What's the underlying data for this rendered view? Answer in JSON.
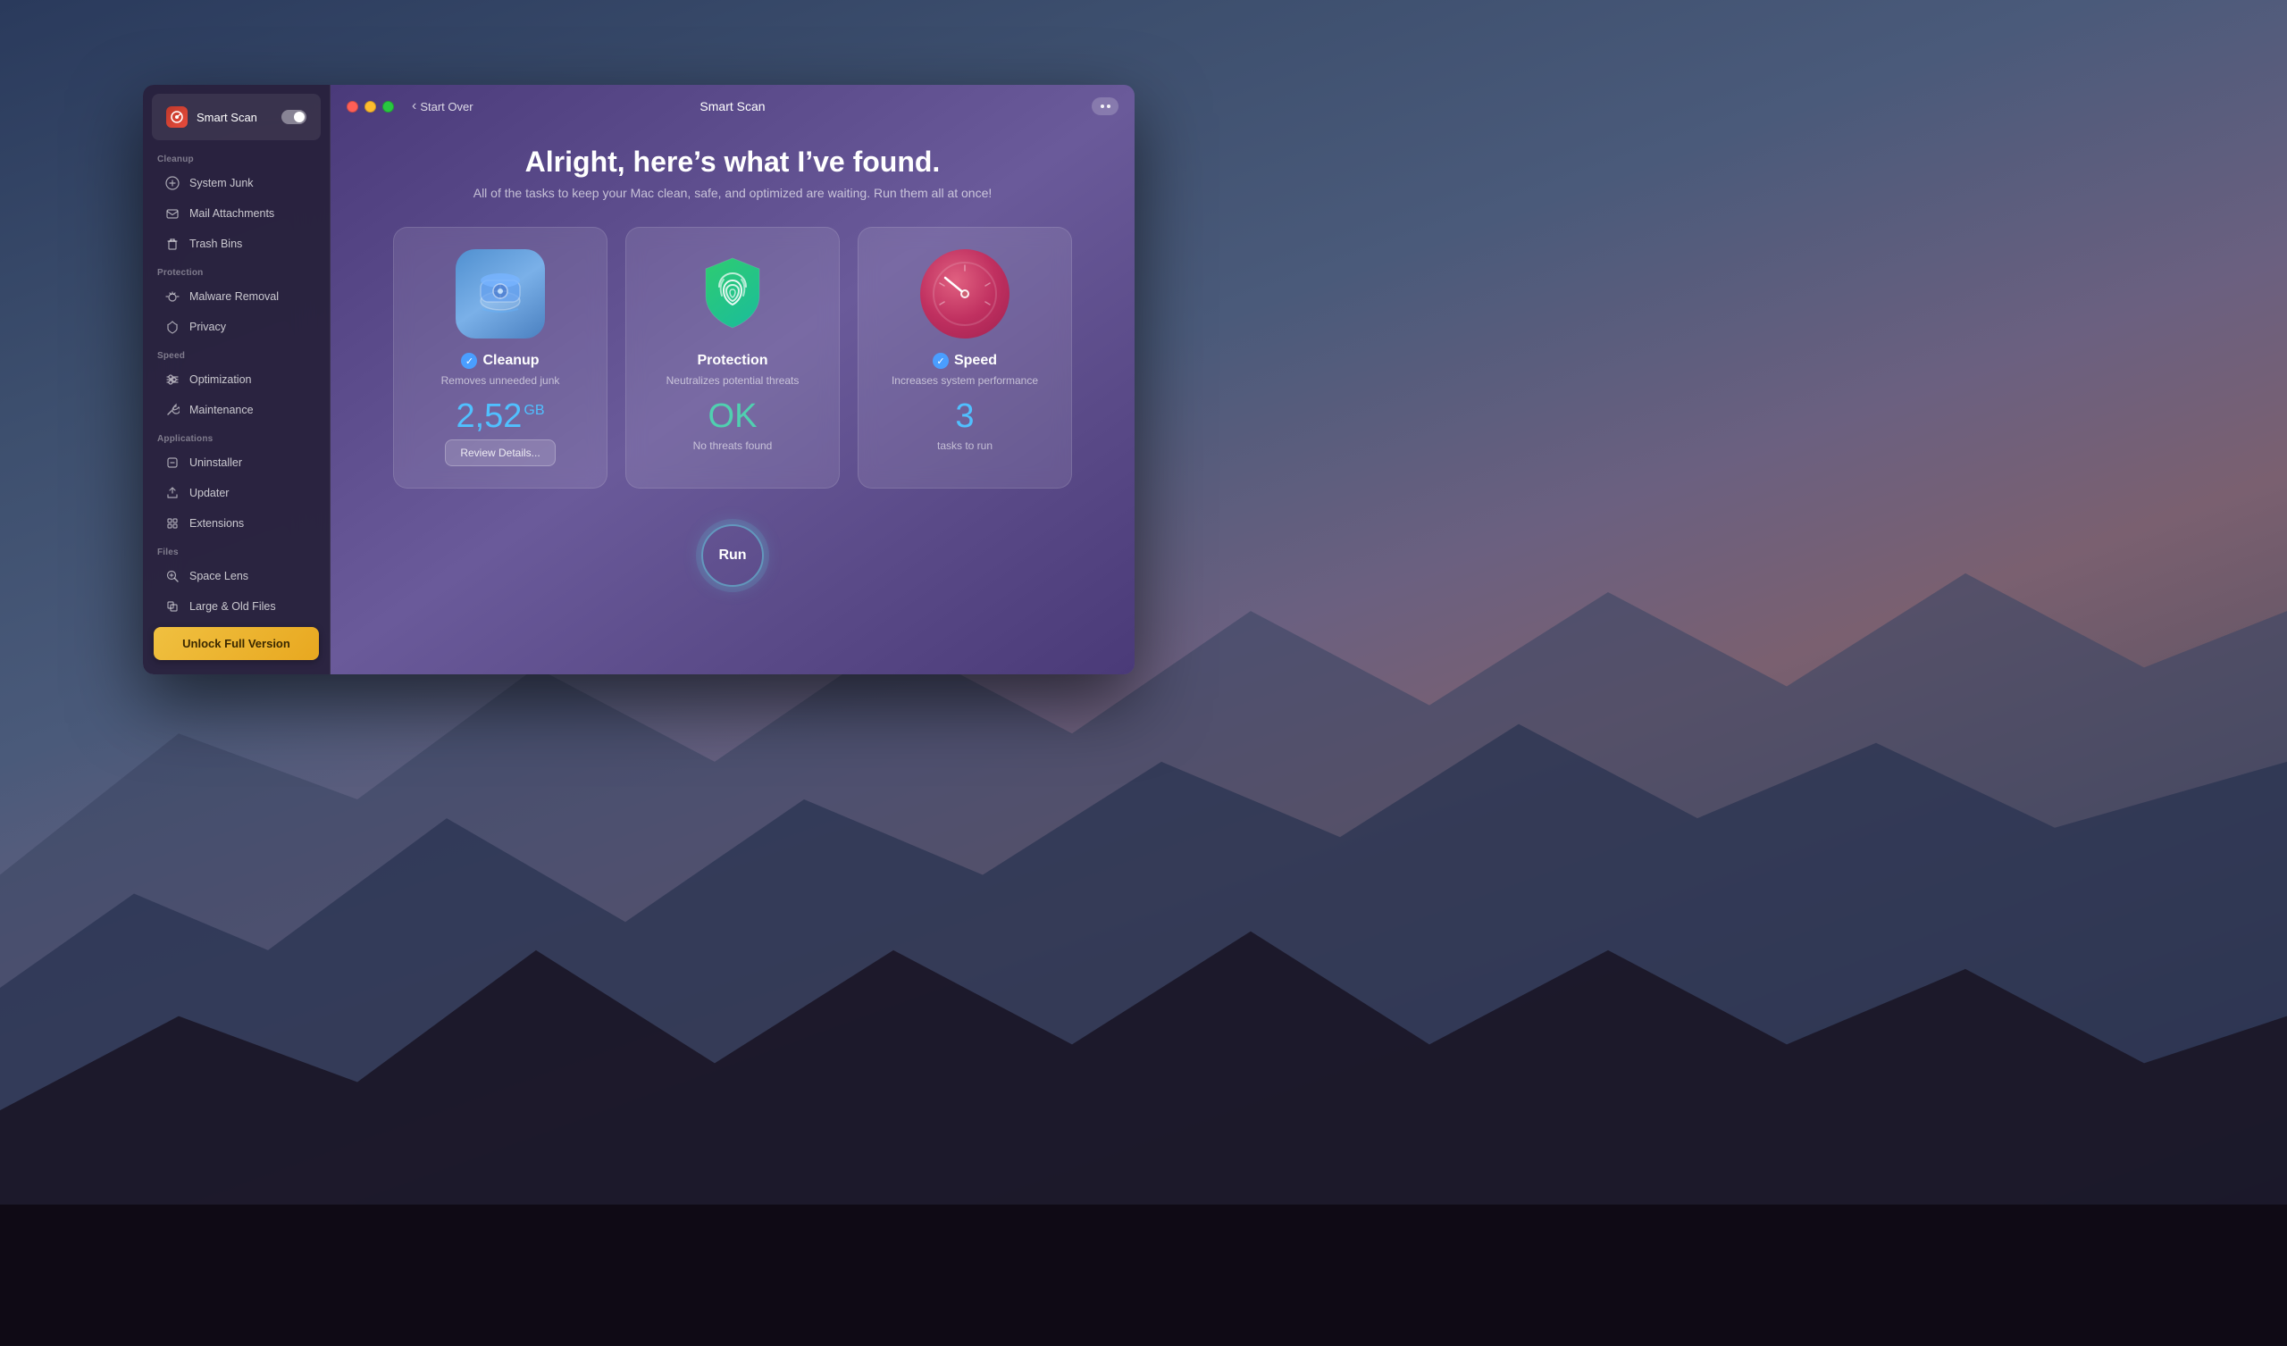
{
  "desktop": {
    "bg_description": "macOS mountain landscape"
  },
  "window": {
    "title": "Smart Scan",
    "back_label": "Start Over",
    "more_icon": "more-icon"
  },
  "sidebar": {
    "smart_scan_label": "Smart Scan",
    "sections": [
      {
        "label": "Cleanup",
        "items": [
          {
            "id": "system-junk",
            "label": "System Junk",
            "icon": "gear-icon"
          },
          {
            "id": "mail-attachments",
            "label": "Mail Attachments",
            "icon": "mail-icon"
          },
          {
            "id": "trash-bins",
            "label": "Trash Bins",
            "icon": "trash-icon"
          }
        ]
      },
      {
        "label": "Protection",
        "items": [
          {
            "id": "malware-removal",
            "label": "Malware Removal",
            "icon": "bug-icon"
          },
          {
            "id": "privacy",
            "label": "Privacy",
            "icon": "eye-icon"
          }
        ]
      },
      {
        "label": "Speed",
        "items": [
          {
            "id": "optimization",
            "label": "Optimization",
            "icon": "slider-icon"
          },
          {
            "id": "maintenance",
            "label": "Maintenance",
            "icon": "wrench-icon"
          }
        ]
      },
      {
        "label": "Applications",
        "items": [
          {
            "id": "uninstaller",
            "label": "Uninstaller",
            "icon": "uninstaller-icon"
          },
          {
            "id": "updater",
            "label": "Updater",
            "icon": "updater-icon"
          },
          {
            "id": "extensions",
            "label": "Extensions",
            "icon": "extensions-icon"
          }
        ]
      },
      {
        "label": "Files",
        "items": [
          {
            "id": "space-lens",
            "label": "Space Lens",
            "icon": "lens-icon"
          },
          {
            "id": "large-old-files",
            "label": "Large & Old Files",
            "icon": "files-icon"
          }
        ]
      }
    ],
    "unlock_label": "Unlock Full Version"
  },
  "main": {
    "heading": "Alright, here’s what I’ve found.",
    "subheading": "All of the tasks to keep your Mac clean, safe, and optimized are waiting. Run them all at once!",
    "cards": [
      {
        "id": "cleanup",
        "title": "Cleanup",
        "has_check": true,
        "subtitle": "Removes unneeded junk",
        "value": "2,52",
        "value_unit": "GB",
        "action_label": "Review Details...",
        "secondary_label": ""
      },
      {
        "id": "protection",
        "title": "Protection",
        "has_check": false,
        "subtitle": "Neutralizes potential threats",
        "value": "OK",
        "secondary_label": "No threats found",
        "action_label": ""
      },
      {
        "id": "speed",
        "title": "Speed",
        "has_check": true,
        "subtitle": "Increases system performance",
        "value": "3",
        "secondary_label": "tasks to run",
        "action_label": ""
      }
    ],
    "run_label": "Run"
  },
  "traffic_lights": {
    "red": "#ff5f57",
    "yellow": "#febc2e",
    "green": "#28c840"
  }
}
